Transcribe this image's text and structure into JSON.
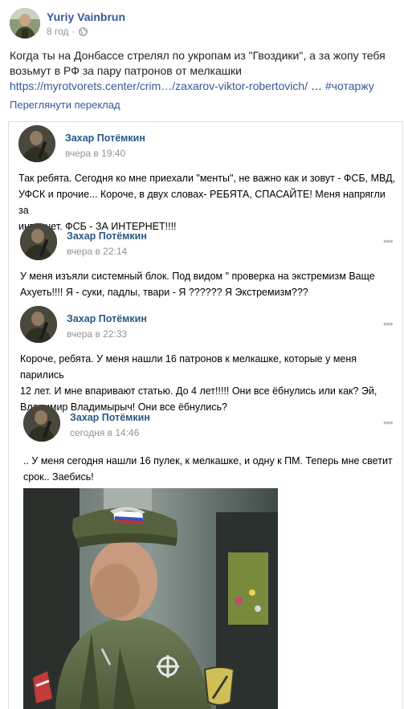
{
  "post": {
    "author": "Yuriy Vainbrun",
    "time": "8 год",
    "dot": "·",
    "text_line1": "Когда ты на Донбассе стрелял по укропам из \"Гвоздики\", а за жопу тебя",
    "text_line2": "возьмут в РФ за пару патронов от мелкашки",
    "link": "https://myrotvorets.center/crim…/zaxarov-viktor-robertovich/",
    "ellipsis": " … ",
    "hashtag": "#чотаржу",
    "translate": "Переглянути переклад"
  },
  "comments": [
    {
      "name": "Захар Потёмкин",
      "time": "вчера в 19:40",
      "lines": [
        "Так ребята. Сегодня ко мне приехали \"менты\", не важно как и зовут - ФСБ, МВД,",
        "УФСК и прочие... Короче, в двух словах- РЕБЯТА, СПАСАЙТЕ! Меня напрягли за",
        "интернет. ФСБ - ЗА ИНТЕРНЕТ!!!!"
      ]
    },
    {
      "name": "Захар Потёмкин",
      "time": "вчера в 22:14",
      "dots": "•••",
      "lines": [
        "У меня изъяли системный блок. Под видом \" проверка на экстремизм Ваще",
        "Ахуеть!!!! Я - суки, падлы, твари - Я ?????? Я Экстремизм???"
      ]
    },
    {
      "name": "Захар Потёмкин",
      "time": "вчера в 22:33",
      "dots": "•••",
      "lines": [
        "Короче, ребята. У меня нашли 16 патронов к мелкашке, которые у меня парились",
        "12 лет. И мне впаривают статью. До 4 лет!!!!! Они все ёбнулись или как? Эй,",
        "Владимир Владимырыч! Они все ёбнулись?"
      ]
    },
    {
      "name": "Захар Потёмкин",
      "time": "сегодня в 14:46",
      "dots": "•••",
      "lines": [
        ".. У меня сегодня нашли 16 пулек, к мелкашке, и одну к ПМ. Теперь мне светит",
        "срок.. Заебись!"
      ]
    }
  ],
  "icons": {
    "globe": "globe-icon",
    "more": "more-dots-icon"
  },
  "colors": {
    "fb_link": "#365899",
    "vk_name": "#2a5885",
    "vk_time": "#939393"
  }
}
